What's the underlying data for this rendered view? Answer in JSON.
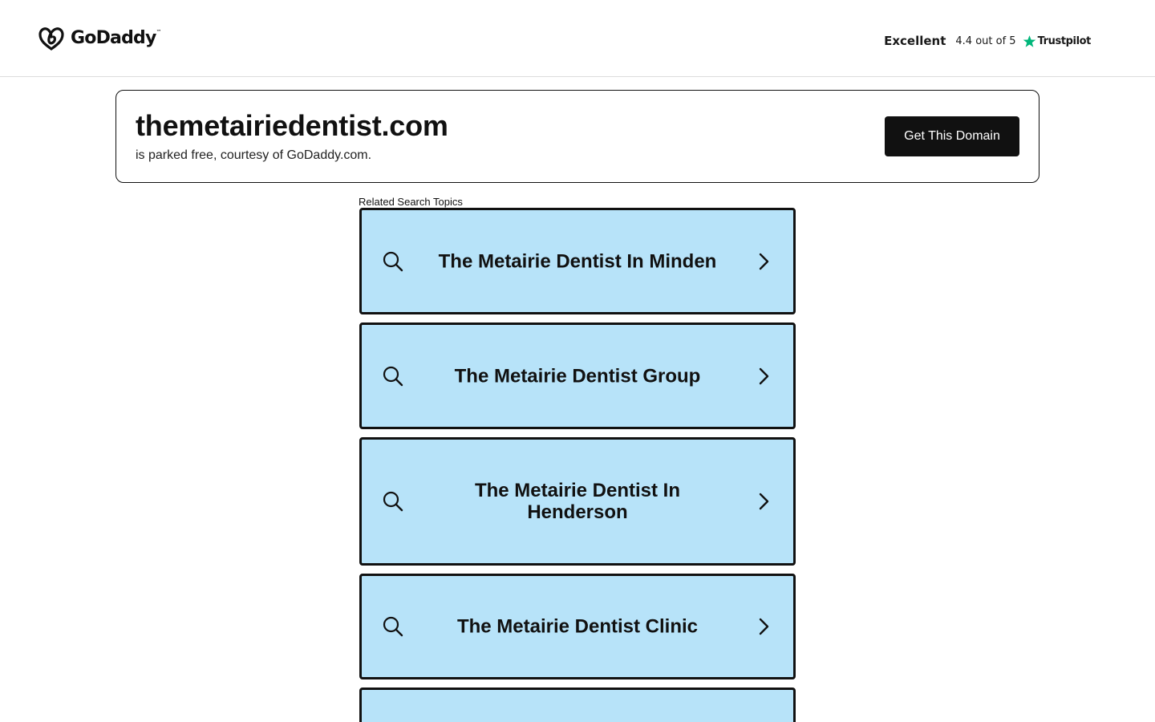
{
  "header": {
    "logo_text": "GoDaddy",
    "logo_tm": "™",
    "trustpilot": {
      "rating_word": "Excellent",
      "score_text": "4.4 out of 5",
      "brand": "Trustpilot",
      "star_color": "#00b67a"
    }
  },
  "domain_card": {
    "domain": "themetairiedentist.com",
    "subtitle": "is parked free, courtesy of GoDaddy.com.",
    "cta_label": "Get This Domain"
  },
  "related": {
    "heading": "Related Search Topics",
    "items": [
      {
        "label": "The Metairie Dentist In Minden",
        "icon": "search-icon"
      },
      {
        "label": "The Metairie Dentist Group",
        "icon": "search-icon"
      },
      {
        "label": "The Metairie Dentist In Henderson",
        "icon": "search-icon"
      },
      {
        "label": "The Metairie Dentist Clinic",
        "icon": "search-icon"
      },
      {
        "label": "",
        "icon": "search-icon"
      }
    ]
  },
  "colors": {
    "topic_background": "#b7e3f9",
    "button_background": "#111111",
    "border": "#111111"
  }
}
